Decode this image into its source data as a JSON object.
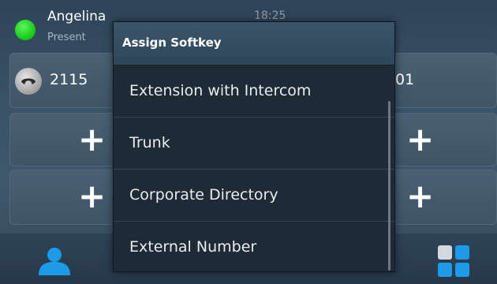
{
  "status": {
    "user_name": "Angelina",
    "presence": "Present",
    "time": "18:25",
    "presence_color": "#1ec41e"
  },
  "line_keys": {
    "left": [
      {
        "label": "2115",
        "icon": "handset-icon"
      },
      {
        "label": "+",
        "icon": "plus-icon"
      },
      {
        "label": "+",
        "icon": "plus-icon"
      }
    ],
    "right": [
      {
        "label": "01"
      },
      {
        "label": "+",
        "icon": "plus-icon"
      },
      {
        "label": "+",
        "icon": "plus-icon"
      }
    ]
  },
  "bottom_bar": {
    "left_icon": "person-icon",
    "right_icon": "apps-grid-icon"
  },
  "dialog": {
    "title": "Assign Softkey",
    "items": [
      {
        "label": "Extension with Intercom"
      },
      {
        "label": "Trunk"
      },
      {
        "label": "Corporate Directory"
      },
      {
        "label": "External Number"
      }
    ]
  },
  "colors": {
    "accent_blue": "#1e9be8",
    "header_bg": "#34495b",
    "dialog_bg": "#1e2a35"
  }
}
